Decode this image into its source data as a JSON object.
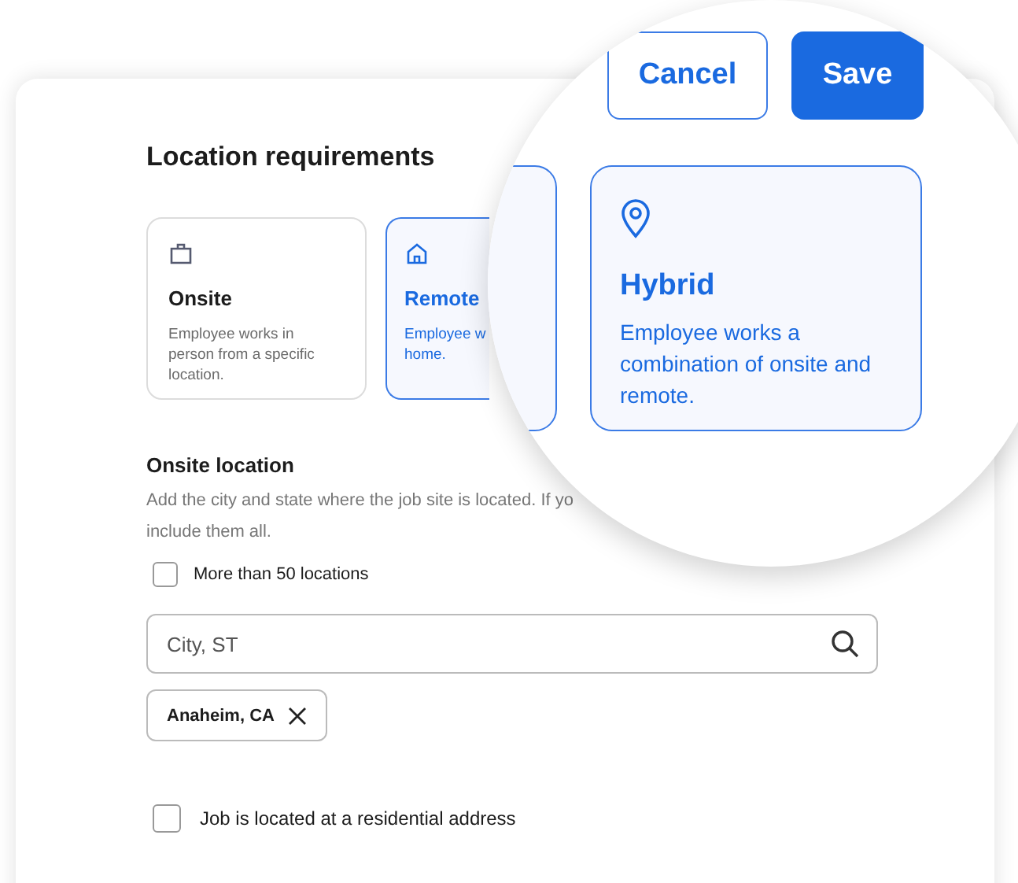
{
  "title": "Location requirements",
  "options": [
    {
      "kind": "onsite",
      "title": "Onsite",
      "description": "Employee works in person from a specific location.",
      "selected": false
    },
    {
      "kind": "remote",
      "title": "Remote",
      "description": "Employee w\nhome.",
      "selected": true
    }
  ],
  "onsite_location": {
    "heading": "Onsite location",
    "description_lines": [
      "Add the city and state where the job site is located. If yo",
      "include them all."
    ],
    "many_locations": {
      "label": "More than 50 locations",
      "checked": false
    },
    "search": {
      "placeholder": "City, ST"
    },
    "tags": [
      {
        "label": "Anaheim, CA"
      }
    ]
  },
  "residential": {
    "label": "Job is located at a residential address",
    "checked": false
  },
  "magnifier": {
    "buttons": [
      {
        "label": "Cancel",
        "kind": "secondary"
      },
      {
        "label": "Save",
        "kind": "primary"
      }
    ],
    "option": {
      "kind": "hybrid",
      "title": "Hybrid",
      "description": "Employee works a combination of onsite and remote.",
      "selected": true
    }
  }
}
